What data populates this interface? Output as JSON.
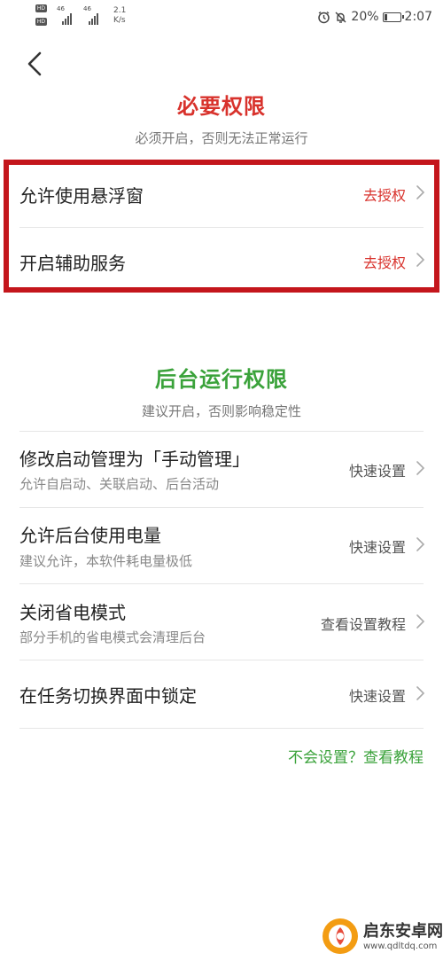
{
  "status_bar": {
    "hd1": "HD",
    "hd2": "HD",
    "hd_sub": "B",
    "sig1": "46",
    "sig2": "46",
    "speed_value": "2.1",
    "speed_unit": "K/s",
    "battery_pct": "20%",
    "battery_level": 0.2,
    "time": "2:07",
    "icons": [
      "alarm-icon",
      "mute-icon",
      "battery-icon"
    ]
  },
  "header": {
    "back_icon": "chevron-left-icon"
  },
  "required": {
    "title": "必要权限",
    "subtitle": "必须开启，否则无法正常运行",
    "items": [
      {
        "label": "允许使用悬浮窗",
        "action": "去授权"
      },
      {
        "label": "开启辅助服务",
        "action": "去授权"
      }
    ]
  },
  "background": {
    "title": "后台运行权限",
    "subtitle": "建议开启，否则影响稳定性",
    "items": [
      {
        "label": "修改启动管理为「手动管理」",
        "desc": "允许自启动、关联启动、后台活动",
        "action": "快速设置"
      },
      {
        "label": "允许后台使用电量",
        "desc": "建议允许，本软件耗电量极低",
        "action": "快速设置"
      },
      {
        "label": "关闭省电模式",
        "desc": "部分手机的省电模式会清理后台",
        "action": "查看设置教程"
      },
      {
        "label": "在任务切换界面中锁定",
        "desc": "",
        "action": "快速设置"
      }
    ]
  },
  "help_link": "不会设置？查看教程",
  "watermark": {
    "name": "启东安卓网",
    "url": "www.qdltdq.com"
  },
  "colors": {
    "red": "#d8322c",
    "green": "#3aa23a",
    "box_border": "#c4161c"
  }
}
